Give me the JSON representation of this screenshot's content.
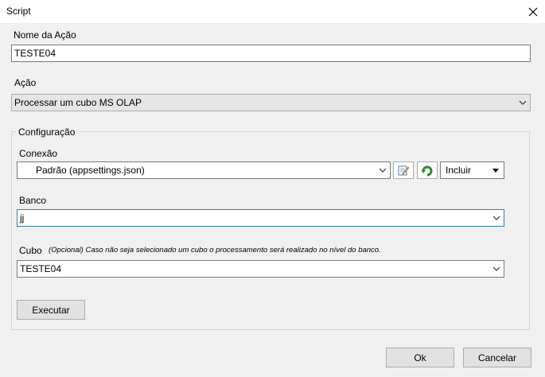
{
  "window": {
    "title": "Script"
  },
  "nome_acao": {
    "label": "Nome da Ação",
    "value": "TESTE04"
  },
  "acao": {
    "label": "Ação",
    "selected": "Processar um cubo MS OLAP"
  },
  "configuracao": {
    "title": "Configuração",
    "conexao": {
      "label": "Conexão",
      "selected": "Padrão (appsettings.json)",
      "include_label": "Incluir"
    },
    "banco": {
      "label": "Banco",
      "value": "jj"
    },
    "cubo": {
      "label": "Cubo",
      "hint": "(Opcional) Caso não seja selecionado um cubo o processamento será realizado no nível do banco.",
      "selected": "TESTE04"
    },
    "execute_label": "Executar"
  },
  "footer": {
    "ok_label": "Ok",
    "cancel_label": "Cancelar"
  }
}
